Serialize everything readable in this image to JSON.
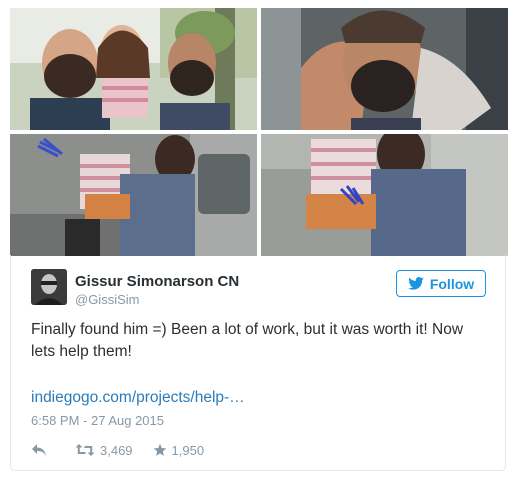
{
  "tweet": {
    "author_name": "Gissur Simonarson CN",
    "author_handle": "@GissiSim",
    "follow_label": "Follow",
    "text": "Finally found him =) Been a lot of work, but it was worth it! Now lets help them!",
    "link_text": "indiegogo.com/projects/help-…",
    "timestamp": "6:58 PM - 27 Aug 2015",
    "retweet_count": "3,469",
    "like_count": "1,950"
  },
  "icons": {
    "follow": "twitter-bird-icon",
    "reply": "reply-icon",
    "retweet": "retweet-icon",
    "like": "star-icon"
  },
  "colors": {
    "accent": "#1b95e0",
    "link": "#2b7bb9",
    "meta": "#8899a6",
    "text": "#292f33"
  }
}
